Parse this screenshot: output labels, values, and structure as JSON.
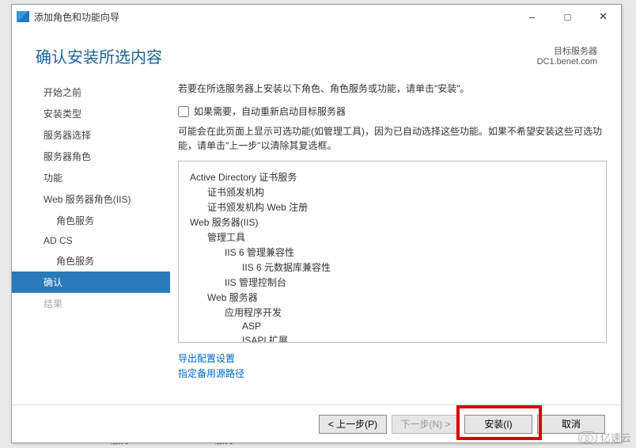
{
  "window": {
    "title": "添加角色和功能向导"
  },
  "header": {
    "page_title": "确认安装所选内容",
    "target_label": "目标服务器",
    "target_server": "DC1.benet.com"
  },
  "sidebar": {
    "items": [
      {
        "label": "开始之前"
      },
      {
        "label": "安装类型"
      },
      {
        "label": "服务器选择"
      },
      {
        "label": "服务器角色"
      },
      {
        "label": "功能"
      },
      {
        "label": "Web 服务器角色(IIS)"
      },
      {
        "label": "角色服务",
        "sub": true
      },
      {
        "label": "AD CS"
      },
      {
        "label": "角色服务",
        "sub": true
      },
      {
        "label": "确认",
        "active": true
      },
      {
        "label": "结果",
        "disabled": true
      }
    ]
  },
  "main": {
    "intro": "若要在所选服务器上安装以下角色、角色服务或功能，请单击\"安装\"。",
    "restart_label": "如果需要，自动重新启动目标服务器",
    "note": "可能会在此页面上显示可选功能(如管理工具)，因为已自动选择这些功能。如果不希望安装这些可选功能，请单击\"上一步\"以清除其复选框。",
    "tree": [
      {
        "l": 0,
        "t": "Active Directory 证书服务"
      },
      {
        "l": 1,
        "t": "证书颁发机构"
      },
      {
        "l": 1,
        "t": "证书颁发机构 Web 注册"
      },
      {
        "l": 0,
        "t": "Web 服务器(IIS)"
      },
      {
        "l": 1,
        "t": "管理工具"
      },
      {
        "l": 2,
        "t": "IIS 6 管理兼容性"
      },
      {
        "l": 3,
        "t": "IIS 6 元数据库兼容性"
      },
      {
        "l": 2,
        "t": "IIS 管理控制台"
      },
      {
        "l": 1,
        "t": "Web 服务器"
      },
      {
        "l": 2,
        "t": "应用程序开发"
      },
      {
        "l": 3,
        "t": "ASP"
      },
      {
        "l": 3,
        "t": "ISAPI 扩展"
      }
    ],
    "links": {
      "export": "导出配置设置",
      "altsrc": "指定备用源路径"
    }
  },
  "footer": {
    "prev": "< 上一步(P)",
    "next": "下一步(N) >",
    "install": "安装(I)",
    "cancel": "取消"
  },
  "bg": {
    "frag1": "服务",
    "frag2": "服务"
  },
  "watermark": "亿速云"
}
